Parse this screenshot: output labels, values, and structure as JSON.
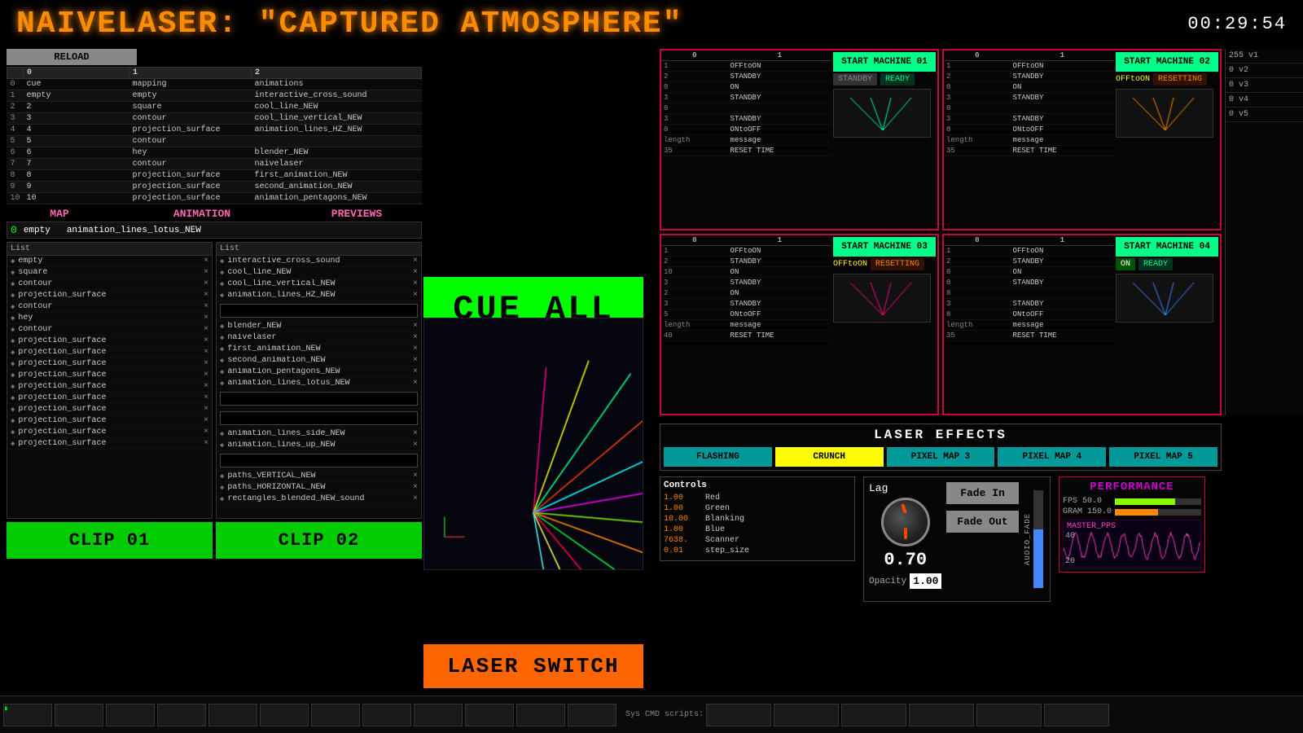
{
  "header": {
    "title": "NAIVELASER: \"CAPTURED ATMOSPHERE\"",
    "timer": "00:29:54"
  },
  "reload_label": "RELOAD",
  "cue_table": {
    "headers": [
      "",
      "0",
      "1",
      "2"
    ],
    "rows": [
      [
        "0",
        "cue",
        "mapping",
        "animations"
      ],
      [
        "1",
        "empty",
        "empty",
        "interactive_cross_sound"
      ],
      [
        "2",
        "2",
        "square",
        "cool_line_NEW"
      ],
      [
        "3",
        "3",
        "contour",
        "cool_line_vertical_NEW"
      ],
      [
        "4",
        "4",
        "projection_surface",
        "animation_lines_HZ_NEW"
      ],
      [
        "5",
        "5",
        "contour",
        ""
      ],
      [
        "6",
        "6",
        "hey",
        "blender_NEW"
      ],
      [
        "7",
        "7",
        "contour",
        "naivelaser"
      ],
      [
        "8",
        "8",
        "projection_surface",
        "first_animation_NEW"
      ],
      [
        "9",
        "9",
        "projection_surface",
        "second_animation_NEW"
      ],
      [
        "10",
        "10",
        "projection_surface",
        "animation_pentagons_NEW"
      ]
    ]
  },
  "section_labels": {
    "map": "MAP",
    "animation": "ANIMATION",
    "previews": "PREVIEWS"
  },
  "cue_row": {
    "number": "0",
    "name": "empty",
    "animation": "animation_lines_lotus_NEW"
  },
  "map_list": {
    "header": "List",
    "items": [
      "empty",
      "square",
      "contour",
      "projection_surface",
      "contour",
      "hey",
      "contour",
      "projection_surface",
      "projection_surface",
      "projection_surface",
      "projection_surface",
      "projection_surface",
      "projection_surface",
      "projection_surface",
      "projection_surface",
      "projection_surface",
      "projection_surface"
    ]
  },
  "anim_list": {
    "header": "List",
    "items": [
      "interactive_cross_sound",
      "cool_line_NEW",
      "cool_line_vertical_NEW",
      "animation_lines_HZ_NEW",
      "",
      "blender_NEW",
      "naivelaser",
      "first_animation_NEW",
      "second_animation_NEW",
      "animation_pentagons_NEW",
      "animation_lines_lotus_NEW",
      "",
      "",
      "animation_lines_side_NEW",
      "animation_lines_up_NEW",
      "",
      "paths_VERTICAL_NEW",
      "paths_HORIZONTAL_NEW",
      "rectangles_blended_NEW_sound"
    ]
  },
  "cue_all_label": "CUE ALL",
  "laser_switch_label": "LASER SWITCH",
  "clips": {
    "clip1": "CLIP 01",
    "clip2": "CLIP 02"
  },
  "machines": [
    {
      "id": "01",
      "start_label": "START MACHINE 01",
      "status_left": "STANDBY",
      "status_right": "READY",
      "rows": [
        {
          "len": "1",
          "msg": "OFFtoON"
        },
        {
          "len": "2",
          "msg": "STANDBY"
        },
        {
          "len": "8",
          "msg": "ON"
        },
        {
          "len": "3",
          "msg": "STANDBY"
        },
        {
          "len": "8",
          "msg": ""
        },
        {
          "len": "3",
          "msg": "STANDBY"
        },
        {
          "len": "8",
          "msg": "ONtoOFF"
        }
      ],
      "bottom_rows": [
        {
          "len": "length",
          "msg": "message"
        },
        {
          "len": "35",
          "msg": "RESET TIME"
        }
      ]
    },
    {
      "id": "02",
      "start_label": "START MACHINE 02",
      "status_left": "OFFtoON",
      "status_right": "RESETTING",
      "rows": [
        {
          "len": "1",
          "msg": "OFFtoON"
        },
        {
          "len": "2",
          "msg": "STANDBY"
        },
        {
          "len": "8",
          "msg": "ON"
        },
        {
          "len": "3",
          "msg": "STANDBY"
        },
        {
          "len": "8",
          "msg": ""
        },
        {
          "len": "3",
          "msg": "STANDBY"
        },
        {
          "len": "8",
          "msg": "ONtoOFF"
        }
      ],
      "bottom_rows": [
        {
          "len": "length",
          "msg": "message"
        },
        {
          "len": "35",
          "msg": "RESET TIME"
        }
      ]
    },
    {
      "id": "03",
      "start_label": "START MACHINE 03",
      "status_left": "OFFtoON",
      "status_right": "RESETTING",
      "rows": [
        {
          "len": "1",
          "msg": "OFFtoON"
        },
        {
          "len": "2",
          "msg": "STANDBY"
        },
        {
          "len": "10",
          "msg": "ON"
        },
        {
          "len": "3",
          "msg": "STANDBY"
        },
        {
          "len": "2",
          "msg": "ON"
        },
        {
          "len": "3",
          "msg": "STANDBY"
        },
        {
          "len": "5",
          "msg": "ONtoOFF"
        }
      ],
      "bottom_rows": [
        {
          "len": "length",
          "msg": "message"
        },
        {
          "len": "40",
          "msg": "RESET TIME"
        }
      ]
    },
    {
      "id": "04",
      "start_label": "START MACHINE 04",
      "status_left": "ON",
      "status_right": "READY",
      "rows": [
        {
          "len": "1",
          "msg": "OFFtoON"
        },
        {
          "len": "2",
          "msg": "STANDBY"
        },
        {
          "len": "8",
          "msg": "ON"
        },
        {
          "len": "8",
          "msg": "STANDBY"
        },
        {
          "len": "8",
          "msg": ""
        },
        {
          "len": "3",
          "msg": "STANDBY"
        },
        {
          "len": "8",
          "msg": "ONtoOFF"
        }
      ],
      "bottom_rows": [
        {
          "len": "length",
          "msg": "message"
        },
        {
          "len": "35",
          "msg": "RESET TIME"
        }
      ]
    }
  ],
  "laser_effects": {
    "title": "LASER  EFFECTS",
    "buttons": [
      {
        "label": "FLASHING",
        "active": false
      },
      {
        "label": "CRUNCH",
        "active": true
      },
      {
        "label": "PIXEL MAP 3",
        "active": false
      },
      {
        "label": "PIXEL MAP 4",
        "active": false
      },
      {
        "label": "PIXEL MAP 5",
        "active": false
      }
    ]
  },
  "controls": {
    "title": "Controls",
    "params": [
      {
        "val": "1.00",
        "name": "Red"
      },
      {
        "val": "1.00",
        "name": "Green"
      },
      {
        "val": "10.00",
        "name": "Blanking"
      },
      {
        "val": "1.00",
        "name": "Blue"
      },
      {
        "val": "7638.",
        "name": "Scanner"
      },
      {
        "val": "0.01",
        "name": "step_size"
      }
    ]
  },
  "lag": {
    "title": "Lag",
    "value": "0.70",
    "fade_in_label": "Fade In",
    "fade_out_label": "Fade Out",
    "opacity_label": "Opacity",
    "opacity_value": "1.00",
    "audio_fade_label": "AUDIO_FADE"
  },
  "performance": {
    "title": "PERFORMANCE",
    "fps_label": "FPS 50.0",
    "gram_label": "GRAM 150.0",
    "master_pps_label": "MASTER_PPS",
    "values": [
      "40",
      "20"
    ]
  },
  "side_panel": {
    "items": [
      {
        "label": "255 v1"
      },
      {
        "label": "0 v2"
      },
      {
        "label": "0 v3"
      },
      {
        "label": "0 v4"
      },
      {
        "label": "0 v5"
      }
    ]
  },
  "status_on_ready": "ON Ready",
  "bottom_bar": {
    "sys_cmd_label": "Sys CMD scripts:"
  }
}
